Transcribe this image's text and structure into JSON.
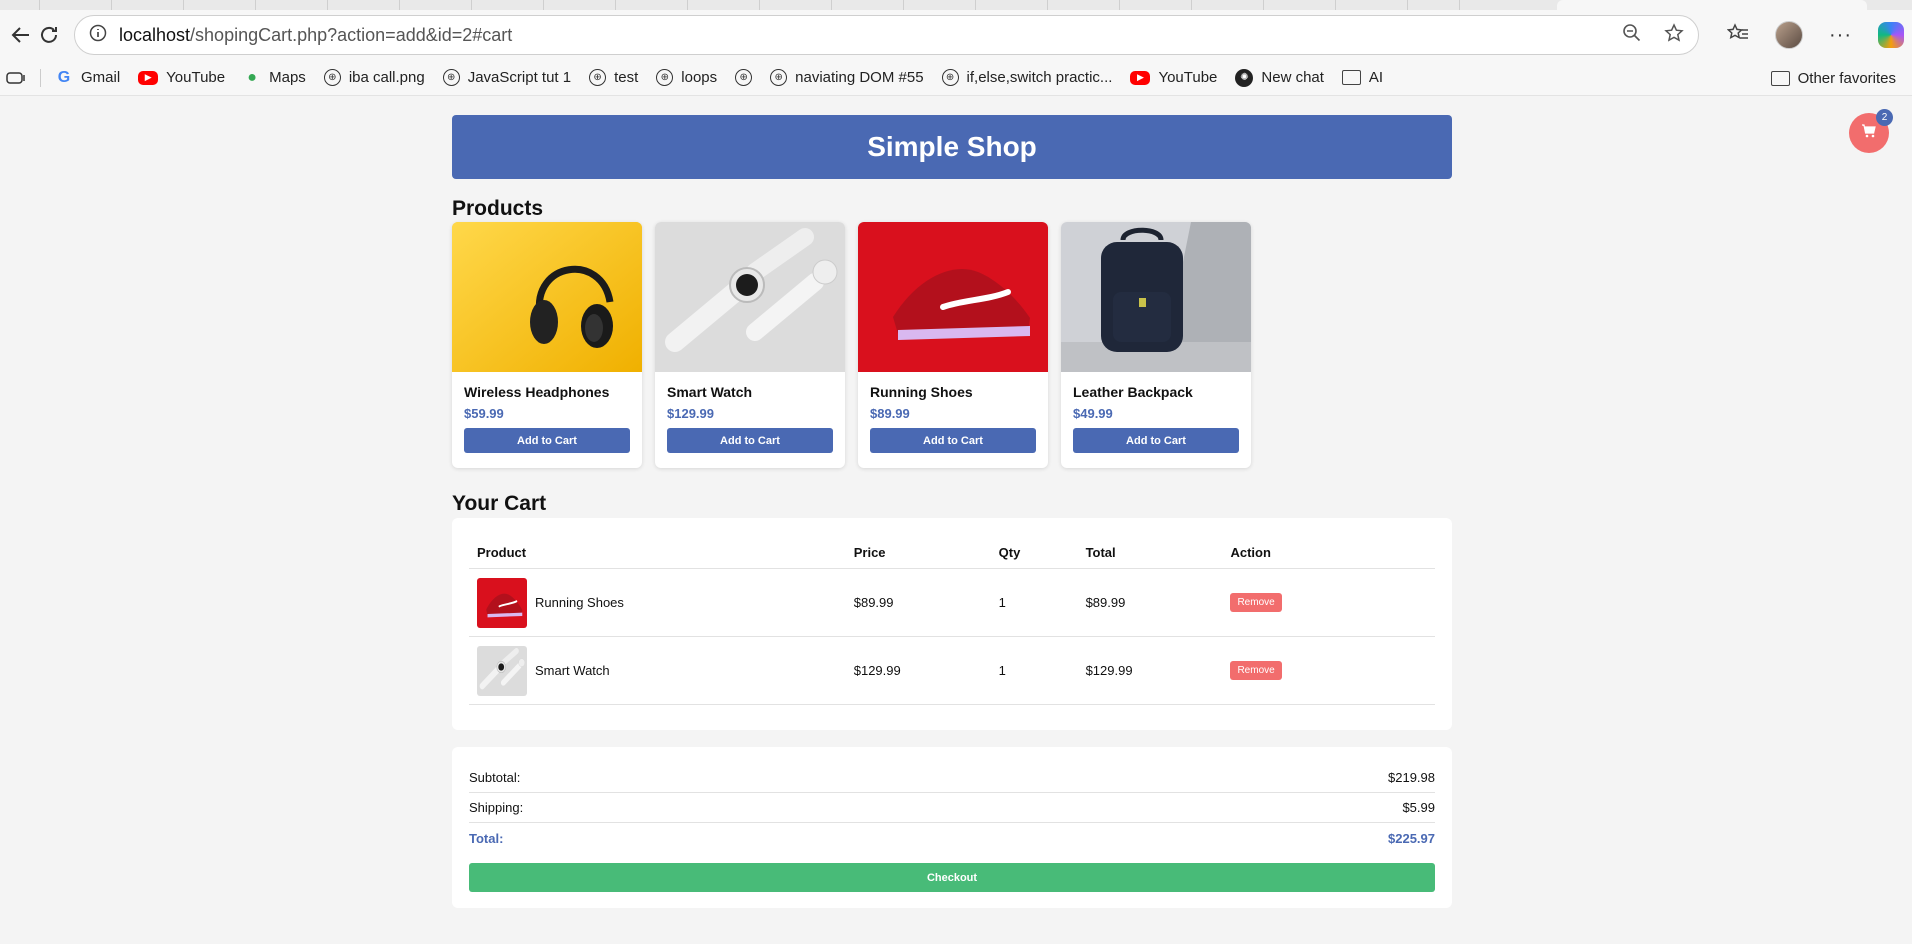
{
  "browser": {
    "url_host": "localhost",
    "url_path": "/shopingCart.php?action=add&id=2#cart",
    "bookmarks": [
      {
        "label": "Gmail",
        "icon": "google-icon"
      },
      {
        "label": "YouTube",
        "icon": "youtube-icon"
      },
      {
        "label": "Maps",
        "icon": "maps-icon"
      },
      {
        "label": "iba call.png",
        "icon": "globe-icon"
      },
      {
        "label": "JavaScript tut 1",
        "icon": "globe-icon"
      },
      {
        "label": "test",
        "icon": "globe-icon"
      },
      {
        "label": "loops",
        "icon": "globe-icon"
      },
      {
        "label": "",
        "icon": "globe-icon"
      },
      {
        "label": "naviating DOM #55",
        "icon": "globe-icon"
      },
      {
        "label": "if,else,switch practic...",
        "icon": "globe-icon"
      },
      {
        "label": "YouTube",
        "icon": "youtube-icon"
      },
      {
        "label": "New chat",
        "icon": "chatgpt-icon"
      },
      {
        "label": "AI",
        "icon": "folder-icon"
      }
    ],
    "other_favorites": "Other favorites"
  },
  "shop": {
    "title": "Simple Shop",
    "products_heading": "Products",
    "cart_heading": "Your Cart",
    "cart_count": "2",
    "products": [
      {
        "name": "Wireless Headphones",
        "price": "$59.99",
        "button": "Add to Cart",
        "image": "headphones"
      },
      {
        "name": "Smart Watch",
        "price": "$129.99",
        "button": "Add to Cart",
        "image": "watch"
      },
      {
        "name": "Running Shoes",
        "price": "$89.99",
        "button": "Add to Cart",
        "image": "shoes"
      },
      {
        "name": "Leather Backpack",
        "price": "$49.99",
        "button": "Add to Cart",
        "image": "backpack"
      }
    ],
    "cart_columns": [
      "Product",
      "Price",
      "Qty",
      "Total",
      "Action"
    ],
    "cart_items": [
      {
        "name": "Running Shoes",
        "price": "$89.99",
        "qty": "1",
        "total": "$89.99",
        "action": "Remove",
        "image": "shoes"
      },
      {
        "name": "Smart Watch",
        "price": "$129.99",
        "qty": "1",
        "total": "$129.99",
        "action": "Remove",
        "image": "watch"
      }
    ],
    "summary": {
      "subtotal_label": "Subtotal:",
      "subtotal": "$219.98",
      "shipping_label": "Shipping:",
      "shipping": "$5.99",
      "total_label": "Total:",
      "total": "$225.97",
      "checkout": "Checkout"
    }
  },
  "colors": {
    "primary": "#4a69b3",
    "danger": "#f26d6d",
    "success": "#48bb78"
  }
}
